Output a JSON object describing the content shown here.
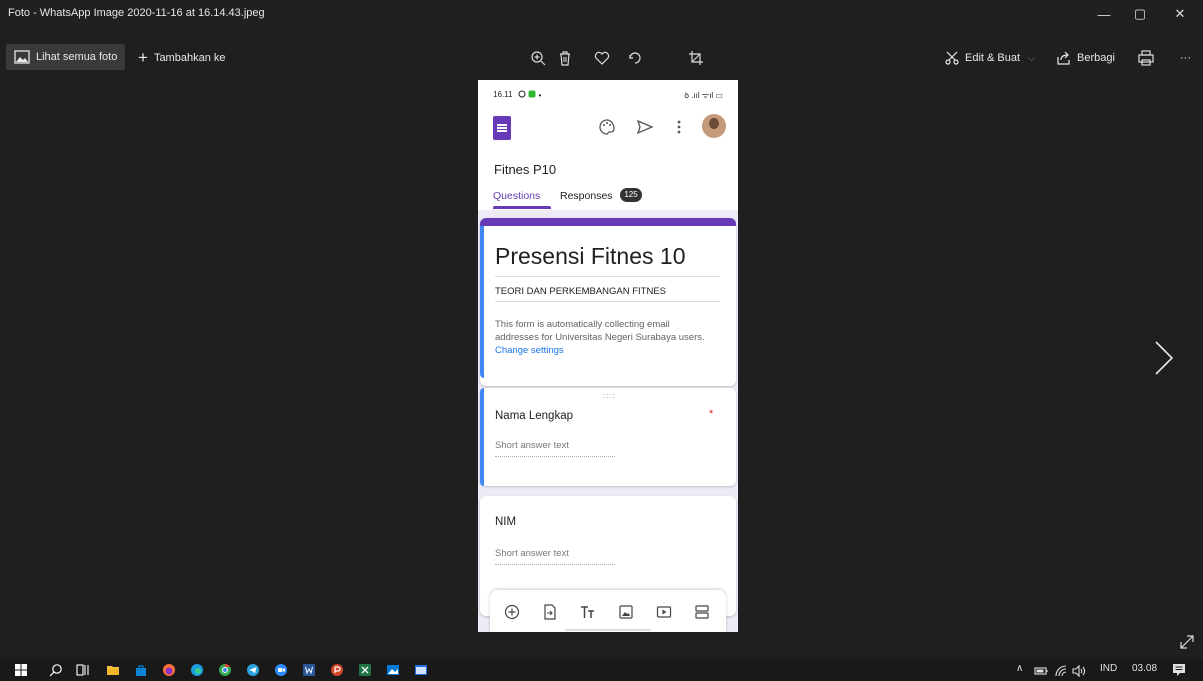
{
  "window": {
    "title": "Foto - WhatsApp Image 2020-11-16 at 16.14.43.jpeg",
    "minimize": "—",
    "restore": "▢",
    "close": "✕"
  },
  "toolbar": {
    "see_all": "Lihat semua foto",
    "add_to": "Tambahkan ke",
    "edit_create": "Edit & Buat",
    "share": "Berbagi",
    "more": "···"
  },
  "phone": {
    "status_time": "16.11",
    "status_right": "ꝺ .ııl ᯤıl ▭",
    "form_name": "Fitnes P10",
    "tabs": {
      "questions": "Questions",
      "responses": "Responses",
      "responses_count": "125"
    },
    "form": {
      "title": "Presensi Fitnes 10",
      "subtitle": "TEORI DAN PERKEMBANGAN FITNES",
      "description": "This form is automatically collecting email addresses for Universitas Negeri Surabaya users.",
      "change_settings": "Change settings"
    },
    "questions": [
      {
        "title": "Nama Lengkap",
        "required_mark": "*",
        "placeholder": "Short answer text"
      },
      {
        "title": "NIM",
        "placeholder": "Short answer text"
      }
    ]
  },
  "taskbar": {
    "language": "IND",
    "time": "03.08"
  },
  "colors": {
    "forms_purple": "#673ab7",
    "selected_blue": "#4285f4",
    "link_blue": "#1a73e8",
    "required_red": "#d93025"
  }
}
